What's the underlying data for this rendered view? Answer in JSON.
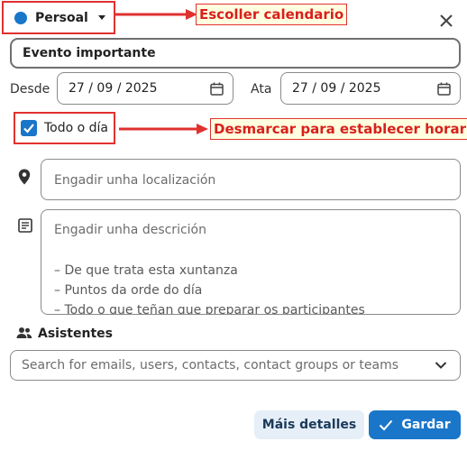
{
  "calendar": {
    "name": "Persoal",
    "color": "#1a76c9"
  },
  "annotations": {
    "choose_calendar": "Escoller calendario",
    "uncheck_for_time": "Desmarcar para establecer horario"
  },
  "event": {
    "title": "Evento importante"
  },
  "dates": {
    "from_label": "Desde",
    "from_value": "27 / 09 / 2025",
    "to_label": "Ata",
    "to_value": "27 / 09 / 2025"
  },
  "all_day": {
    "label": "Todo o día",
    "checked": true
  },
  "location": {
    "placeholder": "Engadir unha localización"
  },
  "description": {
    "placeholder": "Engadir unha descrición",
    "lines": [
      "– De que trata esta xuntanza",
      "– Puntos da orde do día",
      "– Todo o que teñan que preparar os participantes"
    ]
  },
  "attendees": {
    "title": "Asistentes",
    "placeholder": "Search for emails, users, contacts, contact groups or teams"
  },
  "buttons": {
    "more_details": "Máis detalles",
    "save": "Gardar"
  },
  "colors": {
    "accent": "#1a76c9",
    "annotation": "#e0312f"
  }
}
